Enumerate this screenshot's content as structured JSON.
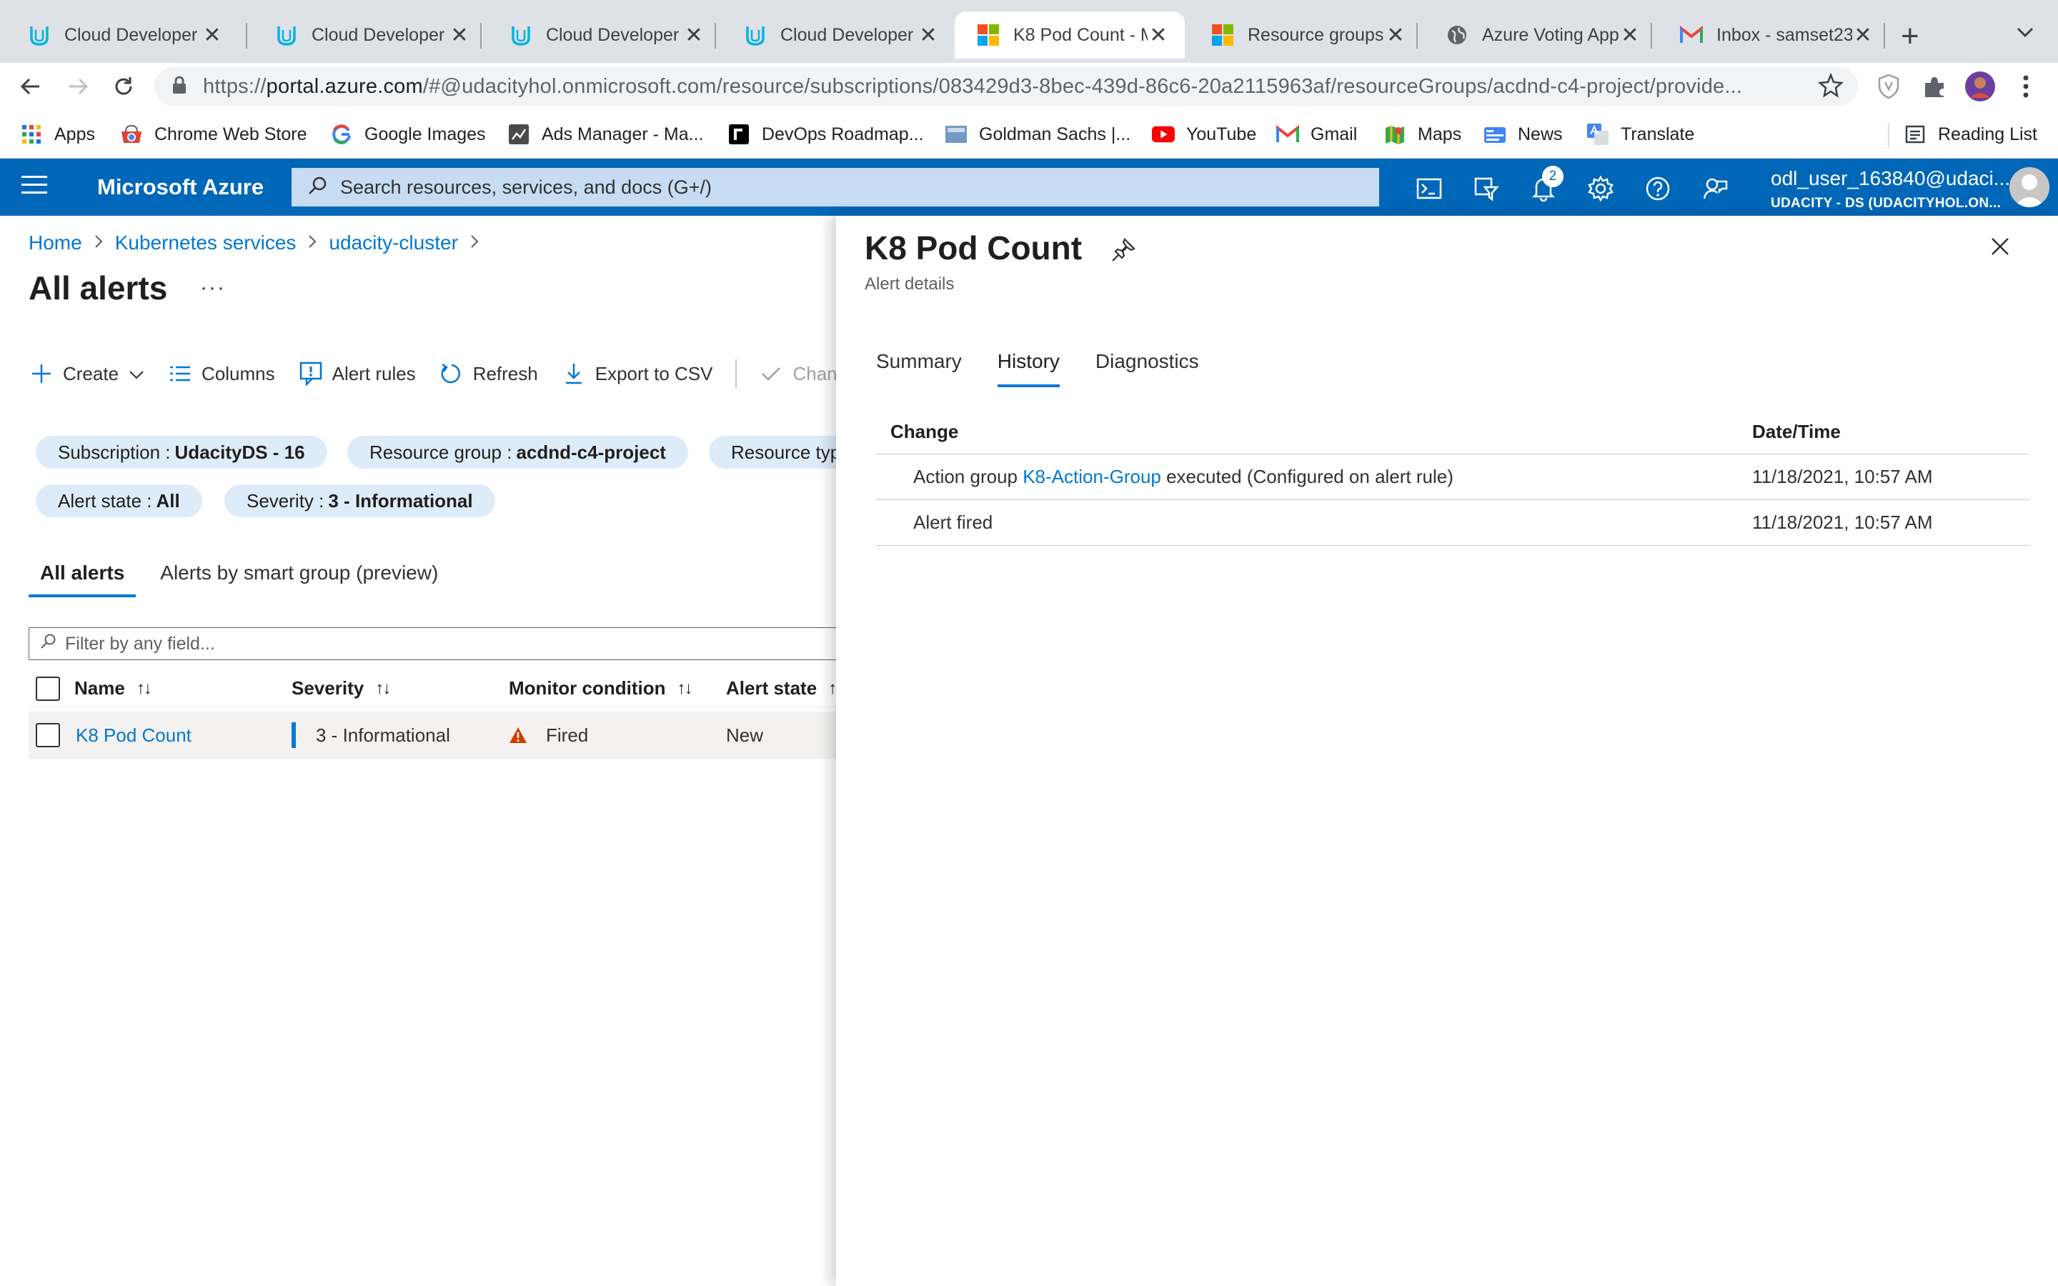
{
  "browser": {
    "tabs": [
      {
        "title": "Cloud Developer",
        "icon": "udacity-icon"
      },
      {
        "title": "Cloud Developer",
        "icon": "udacity-icon"
      },
      {
        "title": "Cloud Developer",
        "icon": "udacity-icon"
      },
      {
        "title": "Cloud Developer",
        "icon": "udacity-icon"
      },
      {
        "title": "K8 Pod Count - M",
        "icon": "microsoft-icon",
        "active": true
      },
      {
        "title": "Resource groups",
        "icon": "microsoft-icon"
      },
      {
        "title": "Azure Voting App",
        "icon": "globe-icon"
      },
      {
        "title": "Inbox - samset23",
        "icon": "gmail-icon"
      }
    ],
    "close_glyph": "✕",
    "new_tab_glyph": "+",
    "url_prefix": "https://",
    "url_host": "portal.azure.com",
    "url_rest": "/#@udacityhol.onmicrosoft.com/resource/subscriptions/083429d3-8bec-439d-86c6-20a2115963af/resourceGroups/acdnd-c4-project/provide...",
    "bookmarks": [
      {
        "label": "Apps",
        "icon": "apps-grid-icon"
      },
      {
        "label": "Chrome Web Store",
        "icon": "chrome-web-store-icon"
      },
      {
        "label": "Google Images",
        "icon": "google-icon"
      },
      {
        "label": "Ads Manager - Ma...",
        "icon": "ads-manager-icon"
      },
      {
        "label": "DevOps Roadmap...",
        "icon": "devops-roadmap-icon"
      },
      {
        "label": "Goldman Sachs |...",
        "icon": "goldman-sachs-icon"
      },
      {
        "label": "YouTube",
        "icon": "youtube-icon"
      },
      {
        "label": "Gmail",
        "icon": "gmail-icon"
      },
      {
        "label": "Maps",
        "icon": "maps-icon"
      },
      {
        "label": "News",
        "icon": "news-icon"
      },
      {
        "label": "Translate",
        "icon": "translate-icon"
      }
    ],
    "reading_list": "Reading List"
  },
  "azure": {
    "brand": "Microsoft Azure",
    "search_placeholder": "Search resources, services, and docs (G+/)",
    "notification_count": "2",
    "user_email": "odl_user_163840@udaci...",
    "user_tenant": "UDACITY - DS (UDACITYHOL.ON..."
  },
  "page": {
    "breadcrumb": [
      "Home",
      "Kubernetes services",
      "udacity-cluster"
    ],
    "title": "All alerts",
    "more": "···",
    "commands": {
      "create": "Create",
      "columns": "Columns",
      "alert_rules": "Alert rules",
      "refresh": "Refresh",
      "export": "Export to CSV",
      "change": "Chan"
    },
    "filters": [
      {
        "label": "Subscription :",
        "value": "UdacityDS - 16"
      },
      {
        "label": "Resource group :",
        "value": "acdnd-c4-project"
      },
      {
        "label": "Resource typ",
        "value": ""
      },
      {
        "label": "Alert state :",
        "value": "All"
      },
      {
        "label": "Severity :",
        "value": "3 - Informational"
      }
    ],
    "tabs": [
      "All alerts",
      "Alerts by smart group (preview)"
    ],
    "filter_placeholder": "Filter by any field...",
    "columns": [
      "Name",
      "Severity",
      "Monitor condition",
      "Alert state"
    ],
    "sort_glyph": "↑↓",
    "rows": [
      {
        "name": "K8 Pod Count",
        "severity": "3 - Informational",
        "monitor_condition": "Fired",
        "alert_state": "New"
      }
    ]
  },
  "blade": {
    "title": "K8 Pod Count",
    "subtitle": "Alert details",
    "tabs": [
      "Summary",
      "History",
      "Diagnostics"
    ],
    "active_tab": "History",
    "columns": [
      "Change",
      "Date/Time"
    ],
    "history": [
      {
        "prefix": "Action group ",
        "link": "K8-Action-Group",
        "suffix": " executed (Configured on alert rule)",
        "datetime": "11/18/2021, 10:57 AM"
      },
      {
        "prefix": "Alert fired",
        "link": "",
        "suffix": "",
        "datetime": "11/18/2021, 10:57 AM"
      }
    ]
  },
  "colors": {
    "azure_header": "#0067b8",
    "link": "#0078d4",
    "warning": "#d83b01",
    "pill_bg": "#deecf9"
  }
}
